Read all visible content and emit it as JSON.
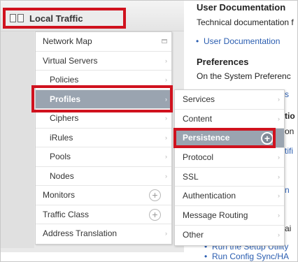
{
  "header": {
    "title": "Local Traffic"
  },
  "menu": {
    "items": [
      {
        "label": "Network Map",
        "type": "ext"
      },
      {
        "label": "Virtual Servers",
        "type": "arrow"
      },
      {
        "label": "Policies",
        "type": "arrow"
      },
      {
        "label": "Profiles",
        "type": "arrow",
        "selected": true
      },
      {
        "label": "Ciphers",
        "type": "arrow"
      },
      {
        "label": "iRules",
        "type": "arrow"
      },
      {
        "label": "Pools",
        "type": "arrow"
      },
      {
        "label": "Nodes",
        "type": "arrow"
      },
      {
        "label": "Monitors",
        "type": "plus"
      },
      {
        "label": "Traffic Class",
        "type": "plus"
      },
      {
        "label": "Address Translation",
        "type": "arrow"
      }
    ],
    "arrow_glyph": "›",
    "plus_glyph": "+"
  },
  "submenu": {
    "items": [
      {
        "label": "Services"
      },
      {
        "label": "Content"
      },
      {
        "label": "Persistence",
        "selected": true
      },
      {
        "label": "Protocol"
      },
      {
        "label": "SSL"
      },
      {
        "label": "Authentication"
      },
      {
        "label": "Message Routing"
      },
      {
        "label": "Other"
      }
    ]
  },
  "right": {
    "heading1": "User Documentation",
    "para1": "Technical documentation f",
    "link1": "User Documentation",
    "heading2": "Preferences",
    "para2": "On the System Preferenc",
    "frag_s": "s",
    "frag_tio": "tio",
    "frag_on": "on",
    "frag_tifi": "tifi",
    "frag_n": "n",
    "frag_ai": "ai",
    "link2": "Run the Setup Utility",
    "link3": "Run Config Sync/HA"
  },
  "colors": {
    "highlight": "#d0121e",
    "selected_bg": "#9aa4b0",
    "link": "#2a5db0"
  }
}
